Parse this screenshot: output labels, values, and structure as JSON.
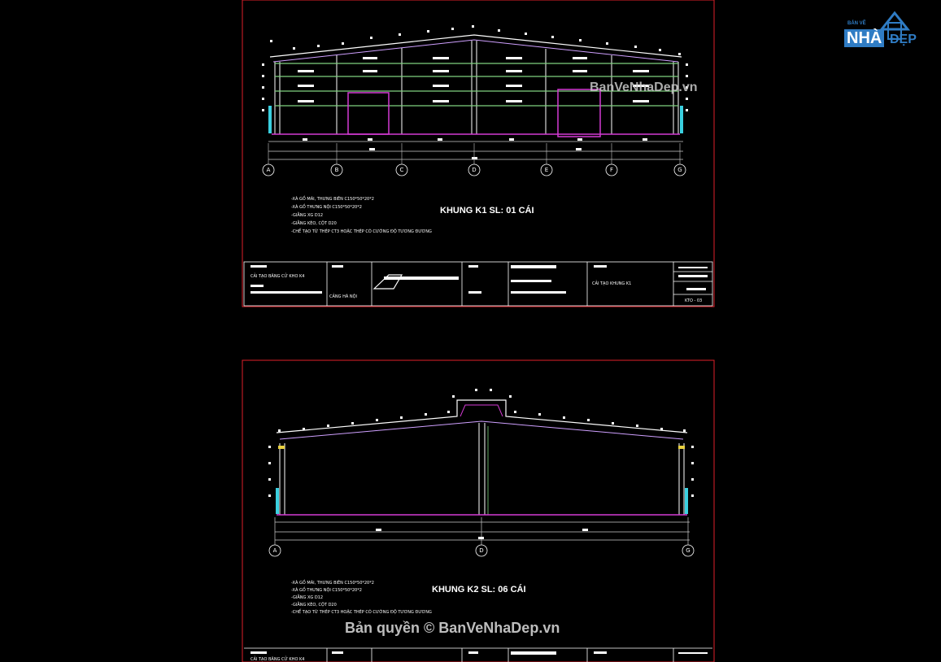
{
  "colors": {
    "background": "#000000",
    "sheet_border": "#e0202a",
    "frame_line": "#ffffff",
    "purlin": "#7fd17f",
    "door": "#d43ad4",
    "roof": "#cfa0ff",
    "column_base": "#3ad0e0",
    "dimension": "#cccccc"
  },
  "sheet1": {
    "title": "KHUNG K1 SL: 01 CÁI",
    "axes": [
      "A",
      "B",
      "C",
      "D",
      "E",
      "F",
      "G"
    ],
    "notes": [
      "-XÀ GỒ MÁI, THƯNG BIÊN C150*50*20*2",
      "-XÀ GỒ THƯNG NỘI C150*50*20*2",
      "-GIẰNG XG D12",
      "-GIẰNG KÈO, CỘT D20",
      "-CHẾ TẠO TỪ THÉP CT3 HOẶC THÉP CÓ CƯỜNG ĐỘ TƯƠNG ĐƯƠNG"
    ],
    "titleblock": {
      "project": "CẢI TẠO BĂNG CỬ KHO K4",
      "location": "CẢNG HÀ NỘI",
      "drawing_name": "CẢI TẠO KHUNG K1",
      "drawing_no": "KTO - 03"
    }
  },
  "sheet2": {
    "title": "KHUNG K2 SL: 06 CÁI",
    "axes": [
      "A",
      "D",
      "G"
    ],
    "notes": [
      "-XÀ GỒ MÁI, THƯNG BIÊN C150*50*20*2",
      "-XÀ GỒ THƯNG NỘI C150*50*20*2",
      "-GIẰNG XG D12",
      "-GIẰNG KÈO, CỘT D20",
      "-CHẾ TẠO TỪ THÉP CT3 HOẶC THÉP CÓ CƯỜNG ĐỘ TƯƠNG ĐƯƠNG"
    ],
    "titleblock": {
      "project": "CẢI TẠO BĂNG CỬ KHO K4"
    }
  },
  "watermarks": {
    "corner": "BanVeNhaDep.vn",
    "bottom": "Bản quyền © BanVeNhaDep.vn"
  },
  "logo": {
    "top": "BẢN VẼ",
    "main": "NHÀ",
    "tail": "ĐẸP",
    "icon": "house-icon"
  }
}
